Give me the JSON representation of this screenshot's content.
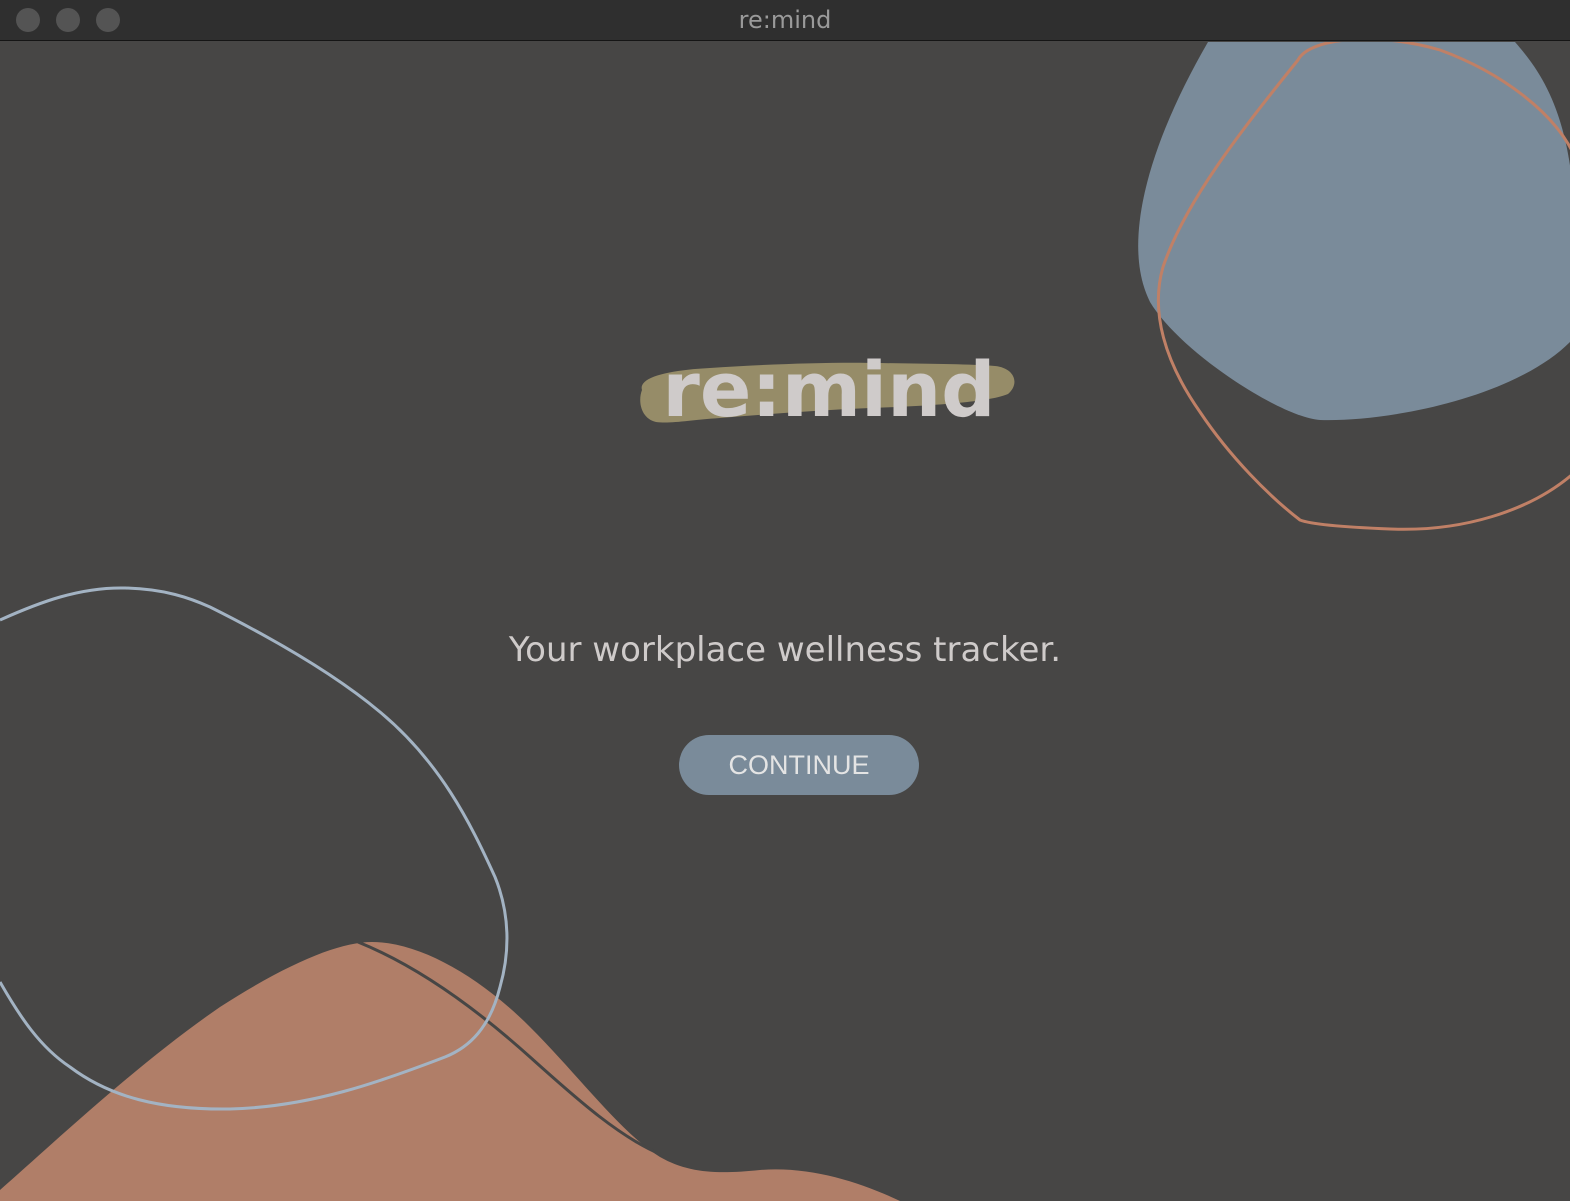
{
  "window": {
    "title": "re:mind"
  },
  "colors": {
    "background": "#474645",
    "titlebar": "#2f2f2f",
    "blue_blob": "#7a8b9a",
    "blue_outline": "#a3b3c3",
    "terracotta": "#b07e68",
    "terracotta_outline": "#c08066",
    "logo_brush": "#968c68",
    "text": "#cfcbca",
    "button": "#7a8b9a"
  },
  "brand": {
    "logo_text": "re:mind"
  },
  "welcome": {
    "tagline": "Your workplace wellness tracker.",
    "continue_label": "CONTINUE"
  }
}
